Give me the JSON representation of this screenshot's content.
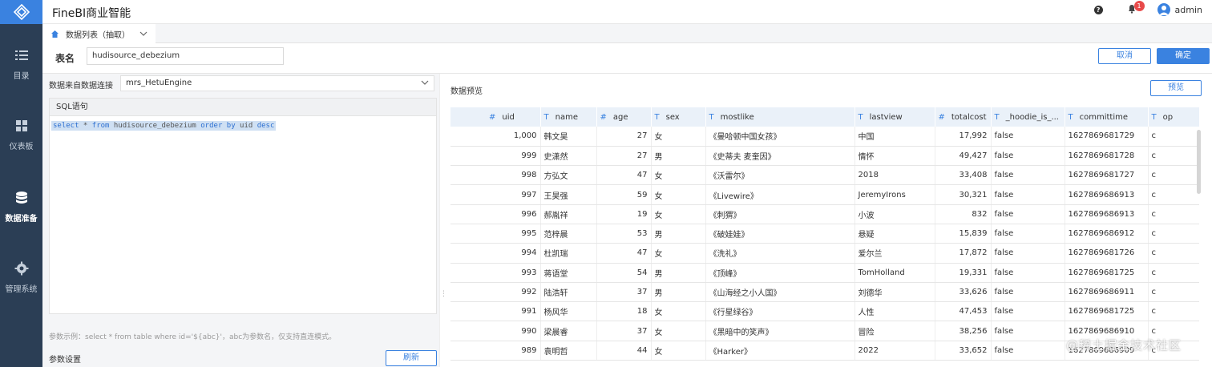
{
  "app": {
    "title": "FineBI商业智能"
  },
  "header": {
    "badge_count": "1",
    "user": "admin"
  },
  "sidebar": {
    "items": [
      {
        "label": "目录",
        "icon": "list-icon",
        "active": false
      },
      {
        "label": "仪表板",
        "icon": "dashboard-icon",
        "active": false
      },
      {
        "label": "数据准备",
        "icon": "database-icon",
        "active": true
      },
      {
        "label": "管理系统",
        "icon": "gear-icon",
        "active": false
      }
    ]
  },
  "tab": {
    "label": "数据列表（抽取）"
  },
  "form": {
    "name_label": "表名",
    "name_value": "hudisource_debezium",
    "cancel": "取消",
    "ok": "确定"
  },
  "left": {
    "conn_label": "数据来自数据连接",
    "conn_value": "mrs_HetuEngine",
    "sql_title": "SQL语句",
    "sql_select": "select",
    "sql_star": " * ",
    "sql_from": "from",
    "sql_table": " hudisource_debezium ",
    "sql_order": "order",
    "sql_by": " by",
    "sql_uid": " uid ",
    "sql_desc": "desc",
    "hint": "参数示例：select * from table where id='${abc}'，abc为参数名，仅支持直连模式。",
    "param_label": "参数设置",
    "refresh": "刷新"
  },
  "preview": {
    "label": "数据预览",
    "button": "预览",
    "columns": [
      {
        "name": "uid",
        "type": "#"
      },
      {
        "name": "name",
        "type": "T"
      },
      {
        "name": "age",
        "type": "#"
      },
      {
        "name": "sex",
        "type": "T"
      },
      {
        "name": "mostlike",
        "type": "T"
      },
      {
        "name": "lastview",
        "type": "T"
      },
      {
        "name": "totalcost",
        "type": "#"
      },
      {
        "name": "_hoodie_is_...",
        "type": "T"
      },
      {
        "name": "committime",
        "type": "T"
      },
      {
        "name": "op",
        "type": "T"
      }
    ],
    "rows": [
      [
        "1,000",
        "韩文昊",
        "27",
        "女",
        "《曼哈顿中国女孩》",
        "中国",
        "17,992",
        "false",
        "1627869681729",
        "c"
      ],
      [
        "999",
        "史潇然",
        "27",
        "男",
        "《史蒂夫 麦奎因》",
        "情怀",
        "49,427",
        "false",
        "1627869681728",
        "c"
      ],
      [
        "998",
        "方弘文",
        "47",
        "女",
        "《沃雷尔》",
        "2018",
        "33,408",
        "false",
        "1627869681727",
        "c"
      ],
      [
        "997",
        "王昊强",
        "59",
        "女",
        "《Livewire》",
        "JeremyIrons",
        "30,321",
        "false",
        "1627869686913",
        "c"
      ],
      [
        "996",
        "郝胤祥",
        "19",
        "女",
        "《刺猬》",
        "小波",
        "832",
        "false",
        "1627869686913",
        "c"
      ],
      [
        "995",
        "范梓晨",
        "53",
        "男",
        "《破娃娃》",
        "悬疑",
        "15,839",
        "false",
        "1627869686912",
        "c"
      ],
      [
        "994",
        "杜凯瑞",
        "47",
        "女",
        "《洗礼》",
        "爱尔兰",
        "17,872",
        "false",
        "1627869681726",
        "c"
      ],
      [
        "993",
        "蒋语堂",
        "54",
        "男",
        "《顶峰》",
        "TomHolland",
        "19,331",
        "false",
        "1627869681725",
        "c"
      ],
      [
        "992",
        "陆浩轩",
        "37",
        "男",
        "《山海经之小人国》",
        "刘德华",
        "33,626",
        "false",
        "1627869686911",
        "c"
      ],
      [
        "991",
        "杨风华",
        "18",
        "女",
        "《行星绿谷》",
        "人性",
        "47,453",
        "false",
        "1627869681725",
        "c"
      ],
      [
        "990",
        "梁晨睿",
        "37",
        "女",
        "《黑暗中的笑声》",
        "冒险",
        "38,256",
        "false",
        "1627869686910",
        "c"
      ],
      [
        "989",
        "袁明哲",
        "44",
        "女",
        "《Harker》",
        "2022",
        "33,652",
        "false",
        "1627869686909",
        "c"
      ]
    ]
  },
  "watermark": "@稀土掘金技术社区"
}
